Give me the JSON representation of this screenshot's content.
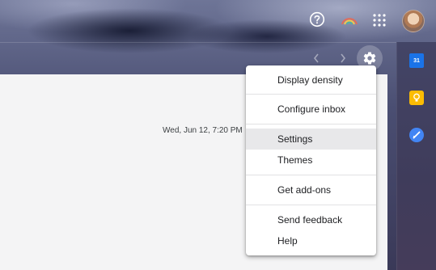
{
  "header": {
    "help_icon": "help-circle-icon",
    "labs_icon": "rainbow-icon",
    "apps_icon": "apps-grid-icon",
    "avatar": "user-avatar"
  },
  "toolbar": {
    "prev_icon": "chevron-left-icon",
    "next_icon": "chevron-right-icon",
    "settings_icon": "gear-icon"
  },
  "email": {
    "date": "Wed, Jun 12, 7:20 PM"
  },
  "side_panel": {
    "calendar_label": "31",
    "icons": [
      "calendar-icon",
      "keep-icon",
      "tasks-icon"
    ],
    "colors": {
      "calendar": "#1a73e8",
      "keep": "#fbbc04",
      "tasks": "#4285f4"
    }
  },
  "settings_menu": {
    "items": [
      {
        "label": "Display density"
      },
      {
        "label": "Configure inbox"
      },
      {
        "label": "Settings",
        "highlighted": true
      },
      {
        "label": "Themes"
      },
      {
        "label": "Get add-ons"
      },
      {
        "label": "Send feedback"
      },
      {
        "label": "Help"
      }
    ]
  }
}
